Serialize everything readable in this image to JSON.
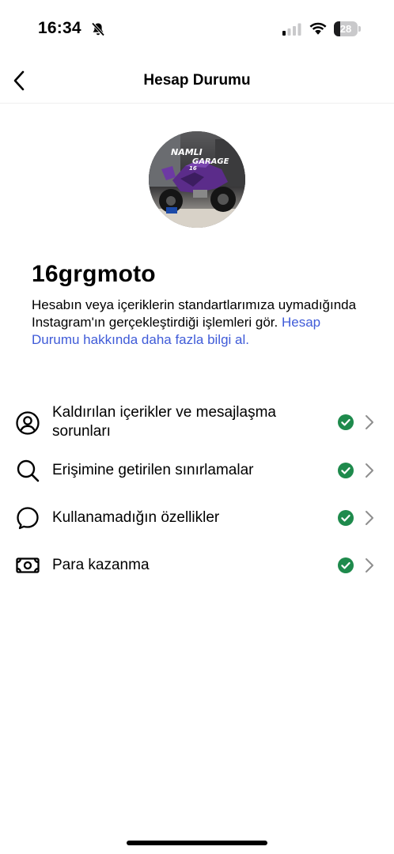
{
  "status_bar": {
    "time": "16:34",
    "battery_level": "28",
    "battery_fraction": 0.28
  },
  "header": {
    "title": "Hesap Durumu",
    "back_icon": "chevron-left-icon"
  },
  "profile": {
    "avatar_text_line1": "NAMLI",
    "avatar_text_line2": "GARAGE",
    "avatar_text_line3": "16",
    "username": "16grgmoto",
    "description": "Hesabın veya içeriklerin standartlarımıza uymadığında Instagram'ın gerçekleştirdiği işlemleri gör.",
    "learn_more_link": "Hesap Durumu hakkında daha fazla bilgi al."
  },
  "colors": {
    "link": "#3f5bd8",
    "check_green": "#1e8a4c"
  },
  "items": [
    {
      "label": "Kaldırılan içerikler ve mesajlaşma sorunları",
      "icon": "person-circle-icon",
      "status": "ok"
    },
    {
      "label": "Erişimine getirilen sınırlamalar",
      "icon": "search-icon",
      "status": "ok"
    },
    {
      "label": "Kullanamadığın özellikler",
      "icon": "speech-bubble-icon",
      "status": "ok"
    },
    {
      "label": "Para kazanma",
      "icon": "money-icon",
      "status": "ok"
    }
  ]
}
